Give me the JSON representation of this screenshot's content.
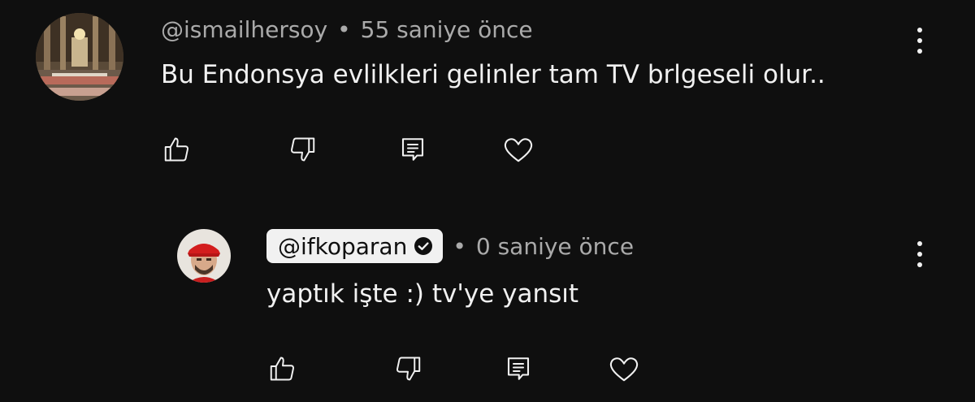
{
  "comments": [
    {
      "author": "@ismailhersoy",
      "time": "55 saniye önce",
      "text": "Bu Endonsya evlilkleri gelinler tam TV brlgeseli olur..",
      "avatar_icon": "mosque-interior-photo",
      "is_creator": false
    },
    {
      "author": "@ifkoparan",
      "time": "0 saniye önce",
      "text": "yaptık işte :) tv'ye yansıt",
      "avatar_icon": "person-red-bandana-photo",
      "is_creator": true,
      "verified_icon": "verified-check-icon"
    }
  ],
  "separator": "•",
  "actions": [
    "like-icon",
    "dislike-icon",
    "reply-icon",
    "heart-icon"
  ],
  "more_icon": "kebab-menu-icon",
  "colors": {
    "background": "#0f0f0f",
    "text": "#f1f1f1",
    "secondary_text": "#aaaaaa",
    "creator_chip_bg": "#f1f1f1"
  }
}
